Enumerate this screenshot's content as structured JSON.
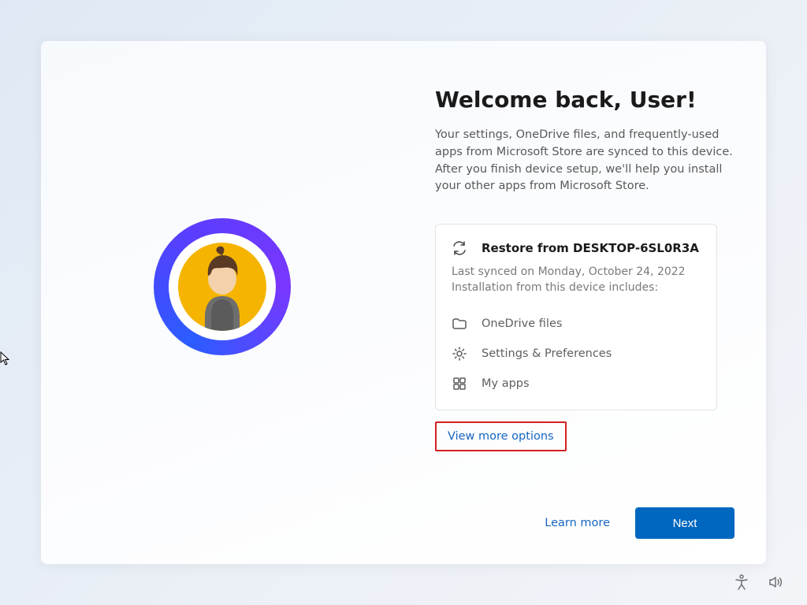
{
  "page": {
    "title": "Welcome back, User!",
    "description": "Your settings, OneDrive files, and frequently-used apps from Microsoft Store are synced to this device. After you finish device setup, we'll help you install your other apps from Microsoft Store."
  },
  "restore": {
    "title": "Restore from DESKTOP-6SL0R3A",
    "last_synced": "Last synced on Monday, October 24, 2022",
    "includes_label": "Installation from this device includes:",
    "items": {
      "onedrive": "OneDrive files",
      "settings": "Settings & Preferences",
      "apps": "My apps"
    }
  },
  "links": {
    "view_more": "View more options",
    "learn_more": "Learn more"
  },
  "buttons": {
    "next": "Next"
  }
}
